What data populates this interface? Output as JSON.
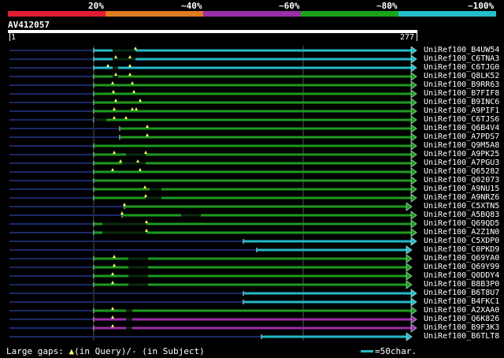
{
  "coverage": {
    "labels": [
      "20%",
      "~40%",
      "~60%",
      "~80%",
      "~100%"
    ],
    "colors": [
      "#e01c32",
      "#e07a20",
      "#9a2ea6",
      "#1aa31a",
      "#22bfcc"
    ]
  },
  "query": {
    "id": "AV412057",
    "start": "1",
    "end": "277"
  },
  "colors": {
    "navy": "#1a2a66",
    "teal": "#25b8c8",
    "green": "#1e9a1e",
    "purple": "#9a2ea6",
    "gap_marker": "#ffff66",
    "grid": "#555555"
  },
  "hits": [
    {
      "id": "UniRef100_B4UW54",
      "color": "teal"
    },
    {
      "id": "UniRef100_C6TNA3",
      "color": "teal"
    },
    {
      "id": "UniRef100_C6TJG0",
      "color": "teal"
    },
    {
      "id": "UniRef100_Q8LK52",
      "color": "green"
    },
    {
      "id": "UniRef100_B9RR63",
      "color": "green"
    },
    {
      "id": "UniRef100_B7FIF8",
      "color": "green"
    },
    {
      "id": "UniRef100_B9INC6",
      "color": "green"
    },
    {
      "id": "UniRef100_A9PIF1",
      "color": "green"
    },
    {
      "id": "UniRef100_C6TJS6",
      "color": "green"
    },
    {
      "id": "UniRef100_Q6B4V4",
      "color": "green"
    },
    {
      "id": "UniRef100_A7PDS7",
      "color": "green"
    },
    {
      "id": "UniRef100_Q9M5A8",
      "color": "green"
    },
    {
      "id": "UniRef100_A9PK25",
      "color": "green"
    },
    {
      "id": "UniRef100_A7PGU3",
      "color": "green"
    },
    {
      "id": "UniRef100_Q65282",
      "color": "green"
    },
    {
      "id": "UniRef100_Q02073",
      "color": "green"
    },
    {
      "id": "UniRef100_A9NU15",
      "color": "green"
    },
    {
      "id": "UniRef100_A9NRZ6",
      "color": "green"
    },
    {
      "id": "UniRef100_C5XTN5",
      "color": "green"
    },
    {
      "id": "UniRef100_A5BQ83",
      "color": "green"
    },
    {
      "id": "UniRef100_Q69QD5",
      "color": "green"
    },
    {
      "id": "UniRef100_A2Z1N0",
      "color": "green"
    },
    {
      "id": "UniRef100_C5XDP0",
      "color": "teal"
    },
    {
      "id": "UniRef100_C0PKD9",
      "color": "teal"
    },
    {
      "id": "UniRef100_Q69YA0",
      "color": "green"
    },
    {
      "id": "UniRef100_Q69Y99",
      "color": "green"
    },
    {
      "id": "UniRef100_Q0DDY4",
      "color": "green"
    },
    {
      "id": "UniRef100_B8B3P0",
      "color": "green"
    },
    {
      "id": "UniRef100_B6T8U7",
      "color": "teal"
    },
    {
      "id": "UniRef100_B4FKC1",
      "color": "teal"
    },
    {
      "id": "UniRef100_A2XAA0",
      "color": "green"
    },
    {
      "id": "UniRef100_Q6K826",
      "color": "purple"
    },
    {
      "id": "UniRef100_B9F3K3",
      "color": "purple"
    },
    {
      "id": "UniRef100_B6TLT8",
      "color": "teal"
    }
  ],
  "legend": {
    "gaps_prefix": "Large gaps: ",
    "gap_marker": "▲",
    "in_query": "(in Query)/",
    "dash": "-",
    "in_subject": " (in Subject)",
    "scale_text": "=50char."
  }
}
